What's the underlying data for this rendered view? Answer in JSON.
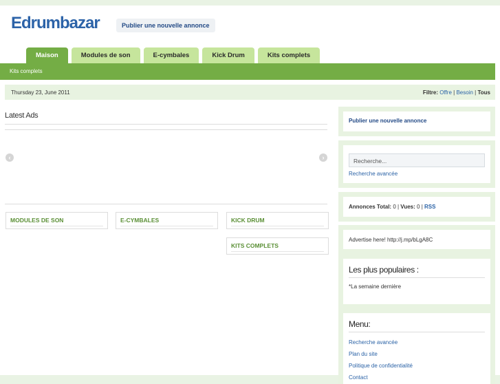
{
  "header": {
    "logo": "Edrumbazar",
    "post_button": "Publier une nouvelle annonce"
  },
  "tabs": [
    {
      "label": "Maison",
      "active": true
    },
    {
      "label": "Modules de son"
    },
    {
      "label": "E-cymbales"
    },
    {
      "label": "Kick Drum"
    },
    {
      "label": "Kits complets"
    }
  ],
  "subnav": {
    "label": "Kits complets"
  },
  "datebar": {
    "date": "Thursday 23, June 2011",
    "filter_label": "Filtre:",
    "filter_offre": "Offre",
    "filter_besoin": "Besoin",
    "filter_tous": "Tous",
    "sep": "|"
  },
  "main": {
    "latest_title": "Latest Ads",
    "categories": [
      "MODULES DE SON",
      "E-CYMBALES",
      "KICK DRUM",
      "KITS COMPLETS"
    ]
  },
  "sidebar": {
    "post_link": "Publier une nouvelle annonce",
    "search_placeholder": "Recherche...",
    "advanced_search": "Recherche avancée",
    "stats_label": "Annonces Total:",
    "stats_total": "0",
    "stats_views_label": "Vues:",
    "stats_views": "0",
    "stats_rss": "RSS",
    "advertise": "Advertise here! http://j.mp/bLgA8C",
    "popular_title": "Les plus populaires :",
    "popular_sub": "*La semaine dernière",
    "menu_title": "Menu:",
    "menu_items": [
      "Recherche avancée",
      "Plan du site",
      "Politique de confidentialité",
      "Contact"
    ]
  },
  "colors": {
    "green": "#74ad45",
    "light_green": "#c6e59c",
    "panel": "#e8f3e1",
    "link": "#2a62a6"
  }
}
